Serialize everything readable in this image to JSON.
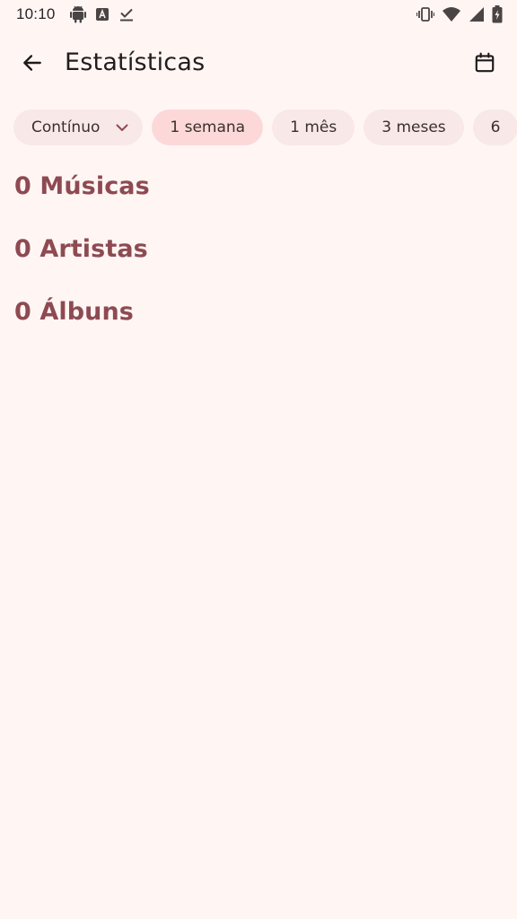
{
  "status_bar": {
    "time": "10:10",
    "icons_left": [
      "android-icon",
      "a-box-icon",
      "download-done-icon"
    ],
    "icons_right": [
      "vibrate-icon",
      "wifi-icon",
      "signal-icon",
      "battery-charging-icon"
    ]
  },
  "app_bar": {
    "title": "Estatísticas",
    "back_icon": "arrow-left-icon",
    "calendar_icon": "calendar-icon"
  },
  "filters": {
    "mode": "Contínuo",
    "ranges": [
      "1 semana",
      "1 mês",
      "3 meses",
      "6"
    ],
    "selected_range": "1 semana"
  },
  "stats": {
    "songs": "0 Músicas",
    "artists": "0 Artistas",
    "albums": "0 Álbuns"
  },
  "colors": {
    "background": "#fff6f4",
    "chip": "#f8e8e7",
    "chip_selected": "#fcd9d8",
    "accent_text": "#8e4a52"
  }
}
